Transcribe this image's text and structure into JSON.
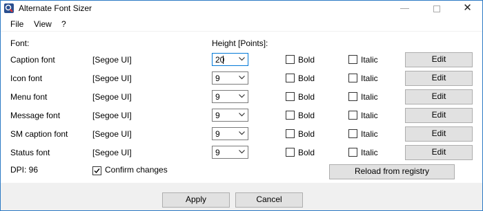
{
  "window": {
    "title": "Alternate Font Sizer",
    "minimize_label": "—",
    "close_label": "✕"
  },
  "menu": [
    "File",
    "View",
    "?"
  ],
  "headers": {
    "font": "Font:",
    "height": "Height [Points]:"
  },
  "rows": [
    {
      "label": "Caption font",
      "font": "[Segoe UI]",
      "height": "20",
      "bold": "Bold",
      "italic": "Italic",
      "edit": "Edit"
    },
    {
      "label": "Icon font",
      "font": "[Segoe UI]",
      "height": "9",
      "bold": "Bold",
      "italic": "Italic",
      "edit": "Edit"
    },
    {
      "label": "Menu font",
      "font": "[Segoe UI]",
      "height": "9",
      "bold": "Bold",
      "italic": "Italic",
      "edit": "Edit"
    },
    {
      "label": "Message font",
      "font": "[Segoe UI]",
      "height": "9",
      "bold": "Bold",
      "italic": "Italic",
      "edit": "Edit"
    },
    {
      "label": "SM caption font",
      "font": "[Segoe UI]",
      "height": "9",
      "bold": "Bold",
      "italic": "Italic",
      "edit": "Edit"
    },
    {
      "label": "Status font",
      "font": "[Segoe UI]",
      "height": "9",
      "bold": "Bold",
      "italic": "Italic",
      "edit": "Edit"
    }
  ],
  "dpi": "DPI: 96",
  "confirm": {
    "label": "Confirm changes",
    "checked": true
  },
  "reload_button": "Reload from registry",
  "footer": {
    "apply": "Apply",
    "cancel": "Cancel"
  },
  "colors": {
    "focus_border": "#0078d7",
    "title_border": "#2b79c4",
    "button_bg": "#e1e1e1"
  }
}
